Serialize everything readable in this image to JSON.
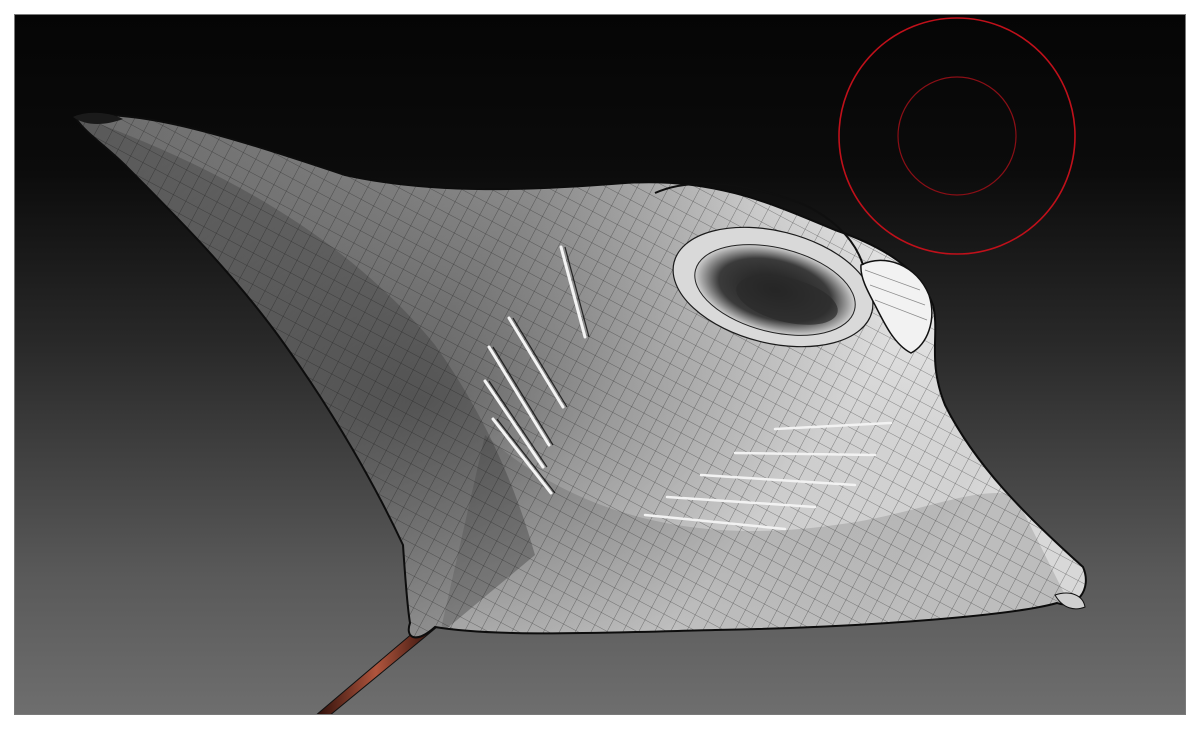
{
  "viewport": {
    "background_top": "#050505",
    "background_bottom": "#6e6e6e",
    "border_color": "#7a7a7a"
  },
  "model": {
    "name_icon": "manta-ray-mesh",
    "wireframe_color": "#1c1c1c",
    "surface_light": "#f0f0f0",
    "surface_dark": "#3a3a3a"
  },
  "brush_cursor": {
    "icon": "brush-radius-cursor",
    "color": "#c0101a"
  },
  "tail": {
    "color": "#8a3a2a"
  }
}
